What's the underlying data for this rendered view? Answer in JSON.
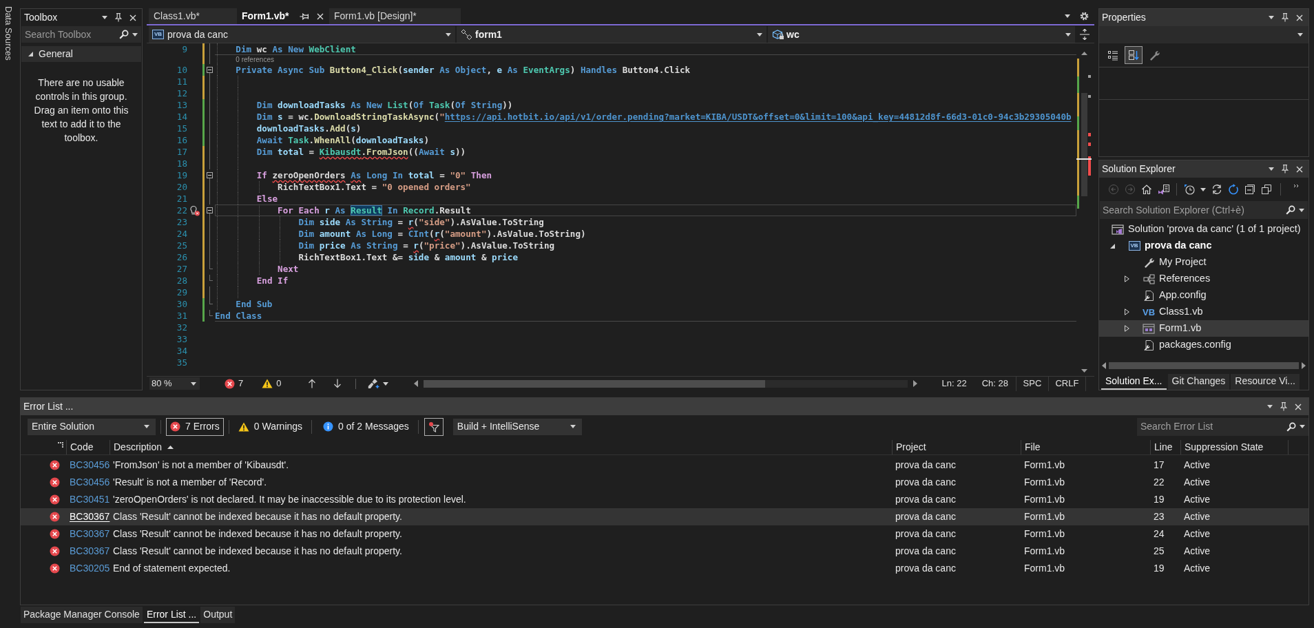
{
  "data_sources_tab": {
    "label": "Data Sources"
  },
  "toolbox": {
    "title": "Toolbox",
    "search": {
      "placeholder": "Search Toolbox"
    },
    "group": {
      "label": "General",
      "expanded": true
    },
    "message": "There are no usable controls in this group. Drag an item onto this text to add it to the toolbox."
  },
  "document_tabs": [
    {
      "label": "Class1.vb*",
      "selected": false
    },
    {
      "label": "Form1.vb*",
      "selected": true
    },
    {
      "label": "Form1.vb [Design]*",
      "selected": false
    }
  ],
  "navigation_bar": {
    "project": {
      "label": "prova da canc",
      "icon_text": "VB"
    },
    "type": {
      "label": "form1"
    },
    "member": {
      "label": "wc"
    }
  },
  "editor": {
    "lines": [
      {
        "kind": "code",
        "number": "9",
        "modified": true,
        "outlined": true,
        "separator": true,
        "tokens": [
          {
            "text": "    Dim ",
            "kind": "keyword"
          },
          {
            "text": "wc ",
            "kind": "plain"
          },
          {
            "text": "As New ",
            "kind": "keyword"
          },
          {
            "text": "WebClient",
            "kind": "type"
          }
        ]
      },
      {
        "kind": "codelens",
        "text": "    0 references",
        "modified": true,
        "outlined": true
      },
      {
        "kind": "code",
        "number": "10",
        "saved": true,
        "outlined": true,
        "collapsible": true,
        "tokens": [
          {
            "text": "    Private Async Sub ",
            "kind": "keyword"
          },
          {
            "text": "Button4_Click",
            "kind": "method"
          },
          {
            "text": "(",
            "kind": "plain"
          },
          {
            "text": "sender ",
            "kind": "local"
          },
          {
            "text": "As Object",
            "kind": "keyword"
          },
          {
            "text": ", ",
            "kind": "plain"
          },
          {
            "text": "e ",
            "kind": "local"
          },
          {
            "text": "As ",
            "kind": "keyword"
          },
          {
            "text": "EventArgs",
            "kind": "type"
          },
          {
            "text": ") ",
            "kind": "plain"
          },
          {
            "text": "Handles ",
            "kind": "keyword"
          },
          {
            "text": "Button4.Click",
            "kind": "plain"
          }
        ]
      },
      {
        "kind": "code",
        "number": "11",
        "modified": true,
        "outlined": true
      },
      {
        "kind": "code",
        "number": "12",
        "modified": true,
        "outlined": true
      },
      {
        "kind": "code",
        "number": "13",
        "saved": true,
        "outlined": true,
        "tokens": [
          {
            "text": "        Dim ",
            "kind": "keyword"
          },
          {
            "text": "downloadTasks ",
            "kind": "local"
          },
          {
            "text": "As New ",
            "kind": "keyword"
          },
          {
            "text": "List",
            "kind": "type"
          },
          {
            "text": "(",
            "kind": "plain"
          },
          {
            "text": "Of ",
            "kind": "keyword"
          },
          {
            "text": "Task",
            "kind": "type"
          },
          {
            "text": "(",
            "kind": "plain"
          },
          {
            "text": "Of String",
            "kind": "keyword"
          },
          {
            "text": "))",
            "kind": "plain"
          }
        ]
      },
      {
        "kind": "code",
        "number": "14",
        "saved": true,
        "outlined": true,
        "tokens": [
          {
            "text": "        Dim ",
            "kind": "keyword"
          },
          {
            "text": "s ",
            "kind": "local"
          },
          {
            "text": "= wc.",
            "kind": "plain"
          },
          {
            "text": "DownloadStringTaskAsync",
            "kind": "method"
          },
          {
            "text": "(",
            "kind": "plain"
          },
          {
            "text": "\"",
            "kind": "string"
          },
          {
            "text": "https://api.hotbit.io/api/v1/order.pending?market=KIBA/USDT&offset=0&limit=100&api_key=44812d8f-66d3-01c0-94c3b29305040b",
            "kind": "link"
          }
        ]
      },
      {
        "kind": "code",
        "number": "15",
        "saved": true,
        "outlined": true,
        "tokens": [
          {
            "text": "        downloadTasks",
            "kind": "local"
          },
          {
            "text": ".",
            "kind": "plain"
          },
          {
            "text": "Add",
            "kind": "method"
          },
          {
            "text": "(",
            "kind": "plain"
          },
          {
            "text": "s",
            "kind": "local"
          },
          {
            "text": ")",
            "kind": "plain"
          }
        ]
      },
      {
        "kind": "code",
        "number": "16",
        "saved": true,
        "outlined": true,
        "tokens": [
          {
            "text": "        Await ",
            "kind": "keyword"
          },
          {
            "text": "Task",
            "kind": "type"
          },
          {
            "text": ".",
            "kind": "plain"
          },
          {
            "text": "WhenAll",
            "kind": "method"
          },
          {
            "text": "(",
            "kind": "plain"
          },
          {
            "text": "downloadTasks",
            "kind": "local"
          },
          {
            "text": ")",
            "kind": "plain"
          }
        ]
      },
      {
        "kind": "code",
        "number": "17",
        "modified": true,
        "outlined": true,
        "tokens": [
          {
            "text": "        Dim ",
            "kind": "keyword"
          },
          {
            "text": "total ",
            "kind": "local"
          },
          {
            "text": "= ",
            "kind": "plain"
          },
          {
            "text": "Kibausdt",
            "kind": "type",
            "squiggle": true
          },
          {
            "text": ".",
            "kind": "plain",
            "squiggle": true
          },
          {
            "text": "FromJson",
            "kind": "method",
            "squiggle": true
          },
          {
            "text": "((",
            "kind": "plain"
          },
          {
            "text": "Await ",
            "kind": "keyword"
          },
          {
            "text": "s",
            "kind": "local"
          },
          {
            "text": "))",
            "kind": "plain"
          }
        ]
      },
      {
        "kind": "code",
        "number": "18",
        "modified": true,
        "outlined": true
      },
      {
        "kind": "code",
        "number": "19",
        "modified": true,
        "outlined": true,
        "collapsible": true,
        "tokens": [
          {
            "text": "        If ",
            "kind": "control"
          },
          {
            "text": "zeroOpenOrders ",
            "kind": "plain",
            "squiggle": true
          },
          {
            "text": "As",
            "kind": "keyword",
            "squiggle": true
          },
          {
            "text": " Long In ",
            "kind": "keyword"
          },
          {
            "text": "total ",
            "kind": "local"
          },
          {
            "text": "= ",
            "kind": "plain"
          },
          {
            "text": "\"0\" ",
            "kind": "string"
          },
          {
            "text": "Then",
            "kind": "control"
          }
        ]
      },
      {
        "kind": "code",
        "number": "20",
        "modified": true,
        "outlined": true,
        "tokens": [
          {
            "text": "            RichTextBox1.Text = ",
            "kind": "plain"
          },
          {
            "text": "\"0 opened orders\"",
            "kind": "string"
          }
        ]
      },
      {
        "kind": "code",
        "number": "21",
        "modified": true,
        "outlined": true,
        "tokens": [
          {
            "text": "        Else",
            "kind": "control"
          }
        ]
      },
      {
        "kind": "code",
        "number": "22",
        "modified": true,
        "outlined": true,
        "collapsible": true,
        "lightbulb": true,
        "current": true,
        "tokens": [
          {
            "text": "            For Each ",
            "kind": "control"
          },
          {
            "text": "r ",
            "kind": "local"
          },
          {
            "text": "As ",
            "kind": "keyword"
          },
          {
            "text": "Result ",
            "kind": "type",
            "highlighted": true
          },
          {
            "text": "In ",
            "kind": "keyword"
          },
          {
            "text": "Record",
            "kind": "type"
          },
          {
            "text": ".Result",
            "kind": "plain"
          }
        ]
      },
      {
        "kind": "code",
        "number": "23",
        "modified": true,
        "outlined": true,
        "tokens": [
          {
            "text": "                Dim ",
            "kind": "keyword"
          },
          {
            "text": "side ",
            "kind": "local"
          },
          {
            "text": "As String ",
            "kind": "keyword"
          },
          {
            "text": "= ",
            "kind": "plain"
          },
          {
            "text": "r",
            "kind": "local",
            "squiggle": true
          },
          {
            "text": "(",
            "kind": "plain"
          },
          {
            "text": "\"side\"",
            "kind": "string"
          },
          {
            "text": ").AsValue.ToString",
            "kind": "plain"
          }
        ]
      },
      {
        "kind": "code",
        "number": "24",
        "modified": true,
        "outlined": true,
        "tokens": [
          {
            "text": "                Dim ",
            "kind": "keyword"
          },
          {
            "text": "amount ",
            "kind": "local"
          },
          {
            "text": "As Long ",
            "kind": "keyword"
          },
          {
            "text": "= ",
            "kind": "plain"
          },
          {
            "text": "CInt",
            "kind": "keyword"
          },
          {
            "text": "(",
            "kind": "plain"
          },
          {
            "text": "r",
            "kind": "local",
            "squiggle": true
          },
          {
            "text": "(",
            "kind": "plain"
          },
          {
            "text": "\"amount\"",
            "kind": "string"
          },
          {
            "text": ").AsValue.ToString)",
            "kind": "plain"
          }
        ]
      },
      {
        "kind": "code",
        "number": "25",
        "modified": true,
        "outlined": true,
        "tokens": [
          {
            "text": "                Dim ",
            "kind": "keyword"
          },
          {
            "text": "price ",
            "kind": "local"
          },
          {
            "text": "As String ",
            "kind": "keyword"
          },
          {
            "text": "= ",
            "kind": "plain"
          },
          {
            "text": "r",
            "kind": "local",
            "squiggle": true
          },
          {
            "text": "(",
            "kind": "plain"
          },
          {
            "text": "\"price\"",
            "kind": "string"
          },
          {
            "text": ").AsValue.ToString",
            "kind": "plain"
          }
        ]
      },
      {
        "kind": "code",
        "number": "26",
        "modified": true,
        "outlined": true,
        "tokens": [
          {
            "text": "                RichTextBox1.Text &= ",
            "kind": "plain"
          },
          {
            "text": "side ",
            "kind": "local"
          },
          {
            "text": "& ",
            "kind": "plain"
          },
          {
            "text": "amount ",
            "kind": "local"
          },
          {
            "text": "& ",
            "kind": "plain"
          },
          {
            "text": "price",
            "kind": "local"
          }
        ]
      },
      {
        "kind": "code",
        "number": "27",
        "modified": true,
        "outlined": true,
        "outline_end": true,
        "tokens": [
          {
            "text": "            Next",
            "kind": "control"
          }
        ]
      },
      {
        "kind": "code",
        "number": "28",
        "modified": true,
        "outlined": true,
        "outline_end": true,
        "tokens": [
          {
            "text": "        End If",
            "kind": "control"
          }
        ]
      },
      {
        "kind": "code",
        "number": "29",
        "modified": true,
        "outlined": true
      },
      {
        "kind": "code",
        "number": "30",
        "saved": true,
        "outlined": true,
        "outline_end": true,
        "tokens": [
          {
            "text": "    End Sub",
            "kind": "keyword"
          }
        ]
      },
      {
        "kind": "code",
        "number": "31",
        "saved": true,
        "outlined": true,
        "outline_end": true,
        "separator": true,
        "tokens": [
          {
            "text": "End Class",
            "kind": "keyword"
          }
        ]
      },
      {
        "kind": "code",
        "number": "32"
      },
      {
        "kind": "code",
        "number": "33"
      },
      {
        "kind": "code",
        "number": "34"
      },
      {
        "kind": "code",
        "number": "35"
      }
    ],
    "zoom": "80 %",
    "error_count": "7",
    "warning_count": "0",
    "caret_line": "Ln: 22",
    "caret_column": "Ch: 28",
    "whitespace_mode": "SPC",
    "line_ending": "CRLF"
  },
  "properties": {
    "title": "Properties",
    "categorized_button": {
      "selected": false
    },
    "alphabetical_button": {
      "selected": true
    }
  },
  "solution_explorer": {
    "title": "Solution Explorer",
    "back_button": {
      "disabled": true
    },
    "forward_button": {
      "disabled": true
    },
    "search": {
      "placeholder": "Search Solution Explorer (Ctrl+è)"
    },
    "tree": [
      {
        "label": "Solution 'prova da canc' (1 of 1 project)",
        "kind": "solution",
        "selected": false,
        "children": [
          {
            "label": "prova da canc",
            "kind": "project",
            "icon_text": "VB",
            "expanded": true,
            "selected": false,
            "children": [
              {
                "label": "My Project",
                "kind": "settings",
                "selected": false
              },
              {
                "label": "References",
                "kind": "references",
                "expanded": false,
                "selected": false
              },
              {
                "label": "App.config",
                "kind": "config",
                "selected": false
              },
              {
                "label": "Class1.vb",
                "kind": "code-file",
                "icon_text": "VB",
                "expanded": false,
                "selected": false
              },
              {
                "label": "Form1.vb",
                "kind": "form",
                "expanded": false,
                "selected": true
              },
              {
                "label": "packages.config",
                "kind": "config",
                "selected": false
              }
            ]
          }
        ]
      }
    ],
    "tabs": [
      {
        "label": "Solution Ex...",
        "selected": true
      },
      {
        "label": "Git Changes",
        "selected": false
      },
      {
        "label": "Resource Vi...",
        "selected": false
      }
    ]
  },
  "error_list": {
    "title": "Error List ...",
    "scope": "Entire Solution",
    "filters": [
      {
        "label": "7 Errors",
        "kind": "error",
        "selected": true
      },
      {
        "label": "0 Warnings",
        "kind": "warning",
        "selected": false
      },
      {
        "label": "0 of 2 Messages",
        "kind": "message",
        "selected": false
      }
    ],
    "filter_button": {
      "selected": true
    },
    "source": "Build + IntelliSense",
    "search": {
      "placeholder": "Search Error List"
    },
    "columns": [
      {
        "label": "Code"
      },
      {
        "label": "Description",
        "sorted": true
      },
      {
        "label": "Project"
      },
      {
        "label": "File"
      },
      {
        "label": "Line"
      },
      {
        "label": "Suppression State"
      }
    ],
    "rows": [
      {
        "kind": "error",
        "code": "BC30456",
        "description": "'FromJson' is not a member of 'Kibausdt'.",
        "project": "prova da canc",
        "file": "Form1.vb",
        "line": "17",
        "suppression_state": "Active",
        "selected": false
      },
      {
        "kind": "error",
        "code": "BC30456",
        "description": "'Result' is not a member of 'Record'.",
        "project": "prova da canc",
        "file": "Form1.vb",
        "line": "22",
        "suppression_state": "Active",
        "selected": false
      },
      {
        "kind": "error",
        "code": "BC30451",
        "description": "'zeroOpenOrders' is not declared. It may be inaccessible due to its protection level.",
        "project": "prova da canc",
        "file": "Form1.vb",
        "line": "19",
        "suppression_state": "Active",
        "selected": false
      },
      {
        "kind": "error",
        "code": "BC30367",
        "description": "Class 'Result' cannot be indexed because it has no default property.",
        "project": "prova da canc",
        "file": "Form1.vb",
        "line": "23",
        "suppression_state": "Active",
        "selected": true
      },
      {
        "kind": "error",
        "code": "BC30367",
        "description": "Class 'Result' cannot be indexed because it has no default property.",
        "project": "prova da canc",
        "file": "Form1.vb",
        "line": "24",
        "suppression_state": "Active",
        "selected": false
      },
      {
        "kind": "error",
        "code": "BC30367",
        "description": "Class 'Result' cannot be indexed because it has no default property.",
        "project": "prova da canc",
        "file": "Form1.vb",
        "line": "25",
        "suppression_state": "Active",
        "selected": false
      },
      {
        "kind": "error",
        "code": "BC30205",
        "description": "End of statement expected.",
        "project": "prova da canc",
        "file": "Form1.vb",
        "line": "19",
        "suppression_state": "Active",
        "selected": false
      }
    ]
  },
  "bottom_tabs": [
    {
      "label": "Package Manager Console",
      "selected": false
    },
    {
      "label": "Error List ...",
      "selected": true
    },
    {
      "label": "Output",
      "selected": false
    }
  ]
}
